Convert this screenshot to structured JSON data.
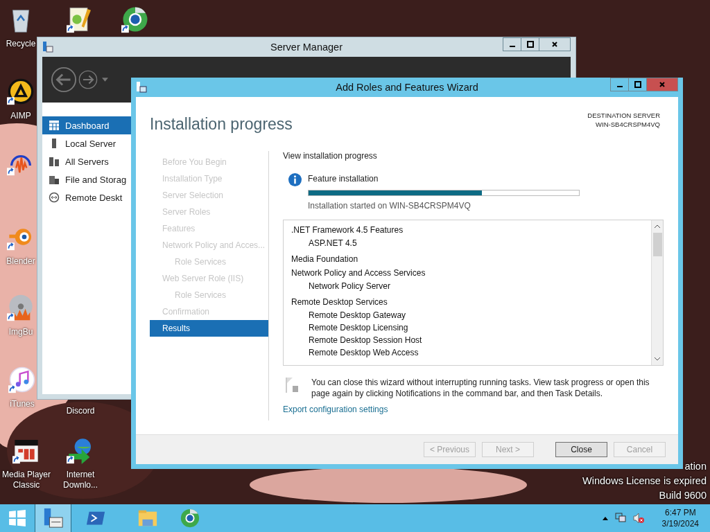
{
  "desktop": {
    "icons": [
      {
        "label": "Recycle",
        "kind": "trash",
        "shortcut": false
      },
      {
        "label": "AIMP",
        "kind": "aimp",
        "shortcut": true
      },
      {
        "kind": "audio",
        "shortcut": true
      },
      {
        "label": "Blender",
        "kind": "blender",
        "shortcut": true
      },
      {
        "label": "ImgBu",
        "kind": "disc",
        "shortcut": true
      },
      {
        "label": "iTunes",
        "kind": "music",
        "shortcut": true
      },
      {
        "label": "Media Player Classic",
        "kind": "player",
        "shortcut": true
      },
      {
        "kind": "notepad",
        "shortcut": true
      },
      {
        "label": "Discord",
        "kind": "none"
      },
      {
        "label": "Internet Downlo...",
        "kind": "globe",
        "shortcut": true
      },
      {
        "kind": "browser",
        "shortcut": true
      }
    ],
    "watermark": [
      "ation",
      "Windows License is expired",
      "Build 9600"
    ]
  },
  "server_manager": {
    "title": "Server Manager",
    "sidebar": [
      {
        "label": "Dashboard",
        "kind": "grid",
        "selected": true
      },
      {
        "label": "Local Server",
        "kind": "server",
        "selected": false
      },
      {
        "label": "All Servers",
        "kind": "servers",
        "selected": false
      },
      {
        "label": "File and Storag",
        "kind": "files",
        "selected": false
      },
      {
        "label": "Remote Deskt",
        "kind": "remote",
        "selected": false
      }
    ]
  },
  "wizard": {
    "title": "Add Roles and Features Wizard",
    "heading": "Installation progress",
    "destination": {
      "label": "DESTINATION SERVER",
      "server": "WIN-SB4CRSPM4VQ"
    },
    "steps": [
      {
        "label": "Before You Begin",
        "selected": false,
        "disabled": true
      },
      {
        "label": "Installation Type",
        "selected": false,
        "disabled": true
      },
      {
        "label": "Server Selection",
        "selected": false,
        "disabled": true
      },
      {
        "label": "Server Roles",
        "selected": false,
        "disabled": true
      },
      {
        "label": "Features",
        "selected": false,
        "disabled": true
      },
      {
        "label": "Network Policy and Acces...",
        "selected": false,
        "disabled": true,
        "children": [
          {
            "label": "Role Services",
            "selected": false,
            "disabled": true
          }
        ]
      },
      {
        "label": "Web Server Role (IIS)",
        "selected": false,
        "disabled": true,
        "children": [
          {
            "label": "Role Services",
            "selected": false,
            "disabled": true
          }
        ]
      },
      {
        "label": "Confirmation",
        "selected": false,
        "disabled": true
      },
      {
        "label": "Results",
        "selected": true,
        "disabled": false
      }
    ],
    "section_title": "View installation progress",
    "progress": {
      "title": "Feature installation",
      "level": 0.64,
      "status": "Installation started on WIN-SB4CRSPM4VQ"
    },
    "features": [
      {
        "label": ".NET Framework 4.5 Features",
        "children": [
          {
            "label": "ASP.NET 4.5"
          }
        ]
      },
      {
        "label": "Media Foundation"
      },
      {
        "label": "Network Policy and Access Services",
        "children": [
          {
            "label": "Network Policy Server"
          }
        ]
      },
      {
        "label": "Remote Desktop Services",
        "children": [
          {
            "label": "Remote Desktop Gateway"
          },
          {
            "label": "Remote Desktop Licensing"
          },
          {
            "label": "Remote Desktop Session Host"
          },
          {
            "label": "Remote Desktop Web Access"
          }
        ]
      }
    ],
    "note": "You can close this wizard without interrupting running tasks. View task progress or open this page again by clicking Notifications in the command bar, and then Task Details.",
    "link": "Export configuration settings",
    "buttons": [
      {
        "label": "< Previous",
        "disabled": true,
        "default": false
      },
      {
        "label": "Next >",
        "disabled": true,
        "default": false
      },
      {
        "label": "Close",
        "disabled": false,
        "default": true
      },
      {
        "label": "Cancel",
        "disabled": true,
        "default": false
      }
    ]
  },
  "taskbar": {
    "apps": [
      {
        "kind": "server-manager",
        "selected": true
      },
      {
        "kind": "powershell",
        "selected": false
      },
      {
        "kind": "explorer",
        "selected": false
      },
      {
        "kind": "browser",
        "selected": false
      }
    ],
    "time": "6:47 PM",
    "date": "3/19/2024"
  }
}
